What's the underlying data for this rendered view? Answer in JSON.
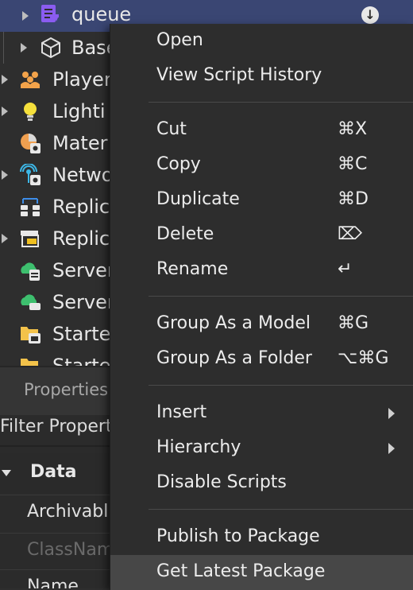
{
  "explorer": {
    "items": [
      {
        "label": "queue",
        "icon": "module-script-icon"
      },
      {
        "label": "Base",
        "icon": "cube-icon"
      },
      {
        "label": "Player",
        "icon": "players-icon"
      },
      {
        "label": "Lighti",
        "icon": "lighting-icon"
      },
      {
        "label": "Mater",
        "icon": "material-service-icon"
      },
      {
        "label": "Netwo",
        "icon": "network-client-icon"
      },
      {
        "label": "Replic",
        "icon": "replicated-first-icon"
      },
      {
        "label": "Replic",
        "icon": "replicated-storage-icon"
      },
      {
        "label": "Server",
        "icon": "server-script-service-icon"
      },
      {
        "label": "Server",
        "icon": "server-storage-icon"
      },
      {
        "label": "Starte",
        "icon": "starter-gui-icon"
      },
      {
        "label": "Starte",
        "icon": "starter-pack-icon"
      }
    ]
  },
  "properties": {
    "title": "Properties",
    "filter_placeholder": "Filter Propert",
    "category": "Data",
    "rows": [
      "Archivabl",
      "ClassNam",
      "Name"
    ]
  },
  "context_menu": {
    "open": "Open",
    "view_script_history": "View Script History",
    "cut": "Cut",
    "cut_shortcut": "⌘X",
    "copy": "Copy",
    "copy_shortcut": "⌘C",
    "duplicate": "Duplicate",
    "duplicate_shortcut": "⌘D",
    "delete": "Delete",
    "delete_shortcut": "⌦",
    "rename": "Rename",
    "rename_shortcut": "↵",
    "group_model": "Group As a Model",
    "group_model_shortcut": "⌘G",
    "group_folder": "Group As a Folder",
    "group_folder_shortcut": "⌥⌘G",
    "insert": "Insert",
    "hierarchy": "Hierarchy",
    "disable_scripts": "Disable Scripts",
    "publish_package": "Publish to Package",
    "get_latest_package": "Get Latest Package"
  }
}
